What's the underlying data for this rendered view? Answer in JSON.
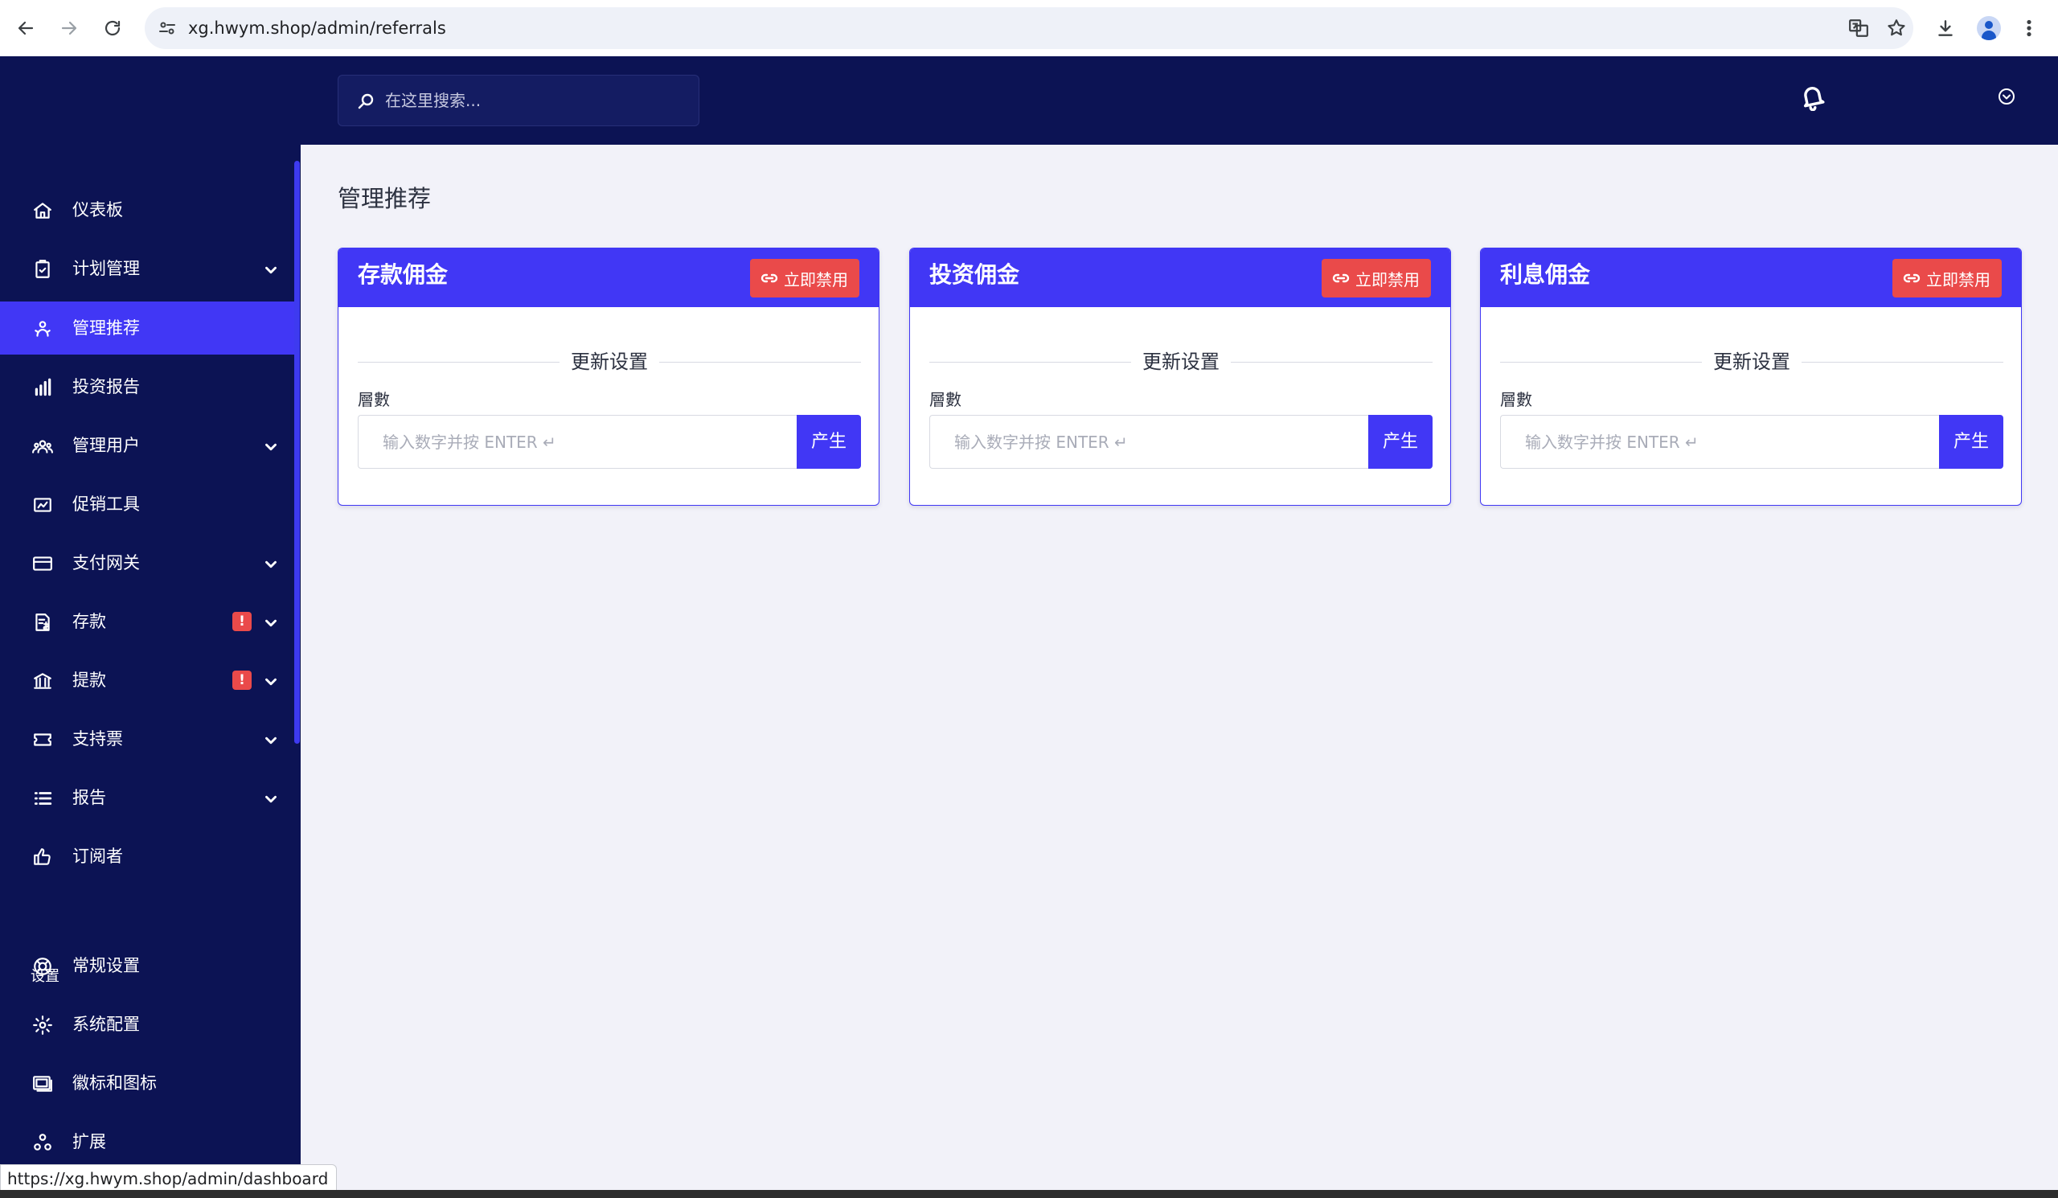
{
  "browser": {
    "url": "xg.hwym.shop/admin/referrals",
    "status_url": "https://xg.hwym.shop/admin/dashboard"
  },
  "header": {
    "search_placeholder": "在这里搜索..."
  },
  "sidebar": {
    "items": [
      {
        "label": "仪表板",
        "icon": "home-icon"
      },
      {
        "label": "计划管理",
        "icon": "clipboard-icon",
        "has_submenu": true
      },
      {
        "label": "管理推荐",
        "icon": "referral-icon",
        "active": true
      },
      {
        "label": "投资报告",
        "icon": "bar-chart-icon"
      },
      {
        "label": "管理用户",
        "icon": "users-icon",
        "has_submenu": true
      },
      {
        "label": "促销工具",
        "icon": "promo-chart-icon"
      },
      {
        "label": "支付网关",
        "icon": "credit-card-icon",
        "has_submenu": true
      },
      {
        "label": "存款",
        "icon": "deposit-icon",
        "has_submenu": true,
        "badge": "!"
      },
      {
        "label": "提款",
        "icon": "bank-icon",
        "has_submenu": true,
        "badge": "!"
      },
      {
        "label": "支持票",
        "icon": "ticket-icon",
        "has_submenu": true
      },
      {
        "label": "报告",
        "icon": "list-icon",
        "has_submenu": true
      },
      {
        "label": "订阅者",
        "icon": "thumbs-up-icon"
      }
    ],
    "section_label": "设置",
    "settings_items": [
      {
        "label": "常规设置",
        "icon": "lifebuoy-icon"
      },
      {
        "label": "系统配置",
        "icon": "gear-icon"
      },
      {
        "label": "徽标和图标",
        "icon": "images-icon"
      },
      {
        "label": "扩展",
        "icon": "extensions-icon"
      }
    ]
  },
  "main": {
    "page_title": "管理推荐",
    "cards": [
      {
        "title": "存款佣金",
        "disable_label": "立即禁用",
        "divider_label": "更新设置",
        "field_label": "層數",
        "input_placeholder": "输入数字并按 ENTER ↵",
        "generate_label": "产生"
      },
      {
        "title": "投资佣金",
        "disable_label": "立即禁用",
        "divider_label": "更新设置",
        "field_label": "層數",
        "input_placeholder": "输入数字并按 ENTER ↵",
        "generate_label": "产生"
      },
      {
        "title": "利息佣金",
        "disable_label": "立即禁用",
        "divider_label": "更新设置",
        "field_label": "層數",
        "input_placeholder": "输入数字并按 ENTER ↵",
        "generate_label": "产生"
      }
    ]
  },
  "colors": {
    "sidebar_bg": "#0c1354",
    "accent": "#4137f5",
    "danger": "#ea4a4a",
    "page_bg": "#f2f2f9"
  }
}
